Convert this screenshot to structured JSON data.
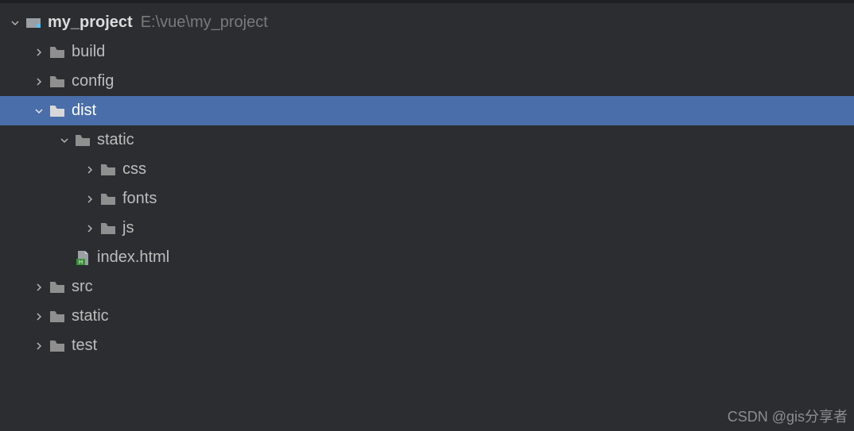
{
  "project": {
    "name": "my_project",
    "path": "E:\\vue\\my_project"
  },
  "tree": {
    "build": "build",
    "config": "config",
    "dist": "dist",
    "static": "static",
    "css": "css",
    "fonts": "fonts",
    "js": "js",
    "indexhtml": "index.html",
    "src": "src",
    "static2": "static",
    "test": "test"
  },
  "watermark": "CSDN @gis分享者"
}
